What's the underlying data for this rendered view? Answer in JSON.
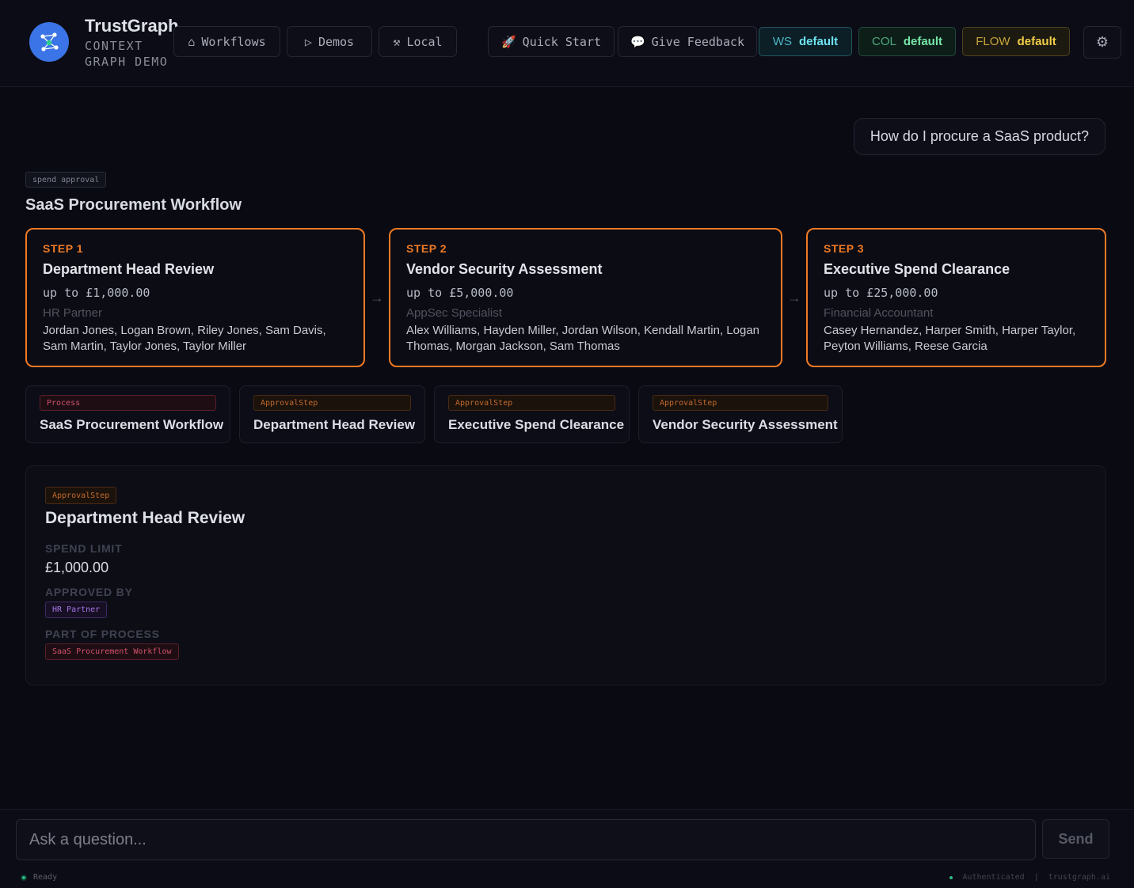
{
  "header": {
    "brand_title": "TrustGraph",
    "brand_subtitle": "CONTEXT GRAPH DEMO",
    "nav": [
      {
        "icon": "home-icon",
        "glyph": "⌂",
        "label": "Workflows"
      },
      {
        "icon": "play-icon",
        "glyph": "▷",
        "label": "Demos"
      },
      {
        "icon": "tools-icon",
        "glyph": "⚒",
        "label": "Local"
      }
    ],
    "quick_start": {
      "glyph": "🚀",
      "label": "Quick Start"
    },
    "feedback": {
      "glyph": "💬",
      "label": "Give Feedback"
    },
    "ws": {
      "key": "WS",
      "value": "default"
    },
    "col": {
      "key": "COL",
      "value": "default"
    },
    "flow": {
      "key": "FLOW",
      "value": "default"
    },
    "settings_glyph": "⚙"
  },
  "chat": {
    "user_message": "How do I procure a SaaS product?"
  },
  "workflow": {
    "tag": "spend approval",
    "title": "SaaS Procurement Workflow",
    "arrow": "→",
    "steps": [
      {
        "label": "STEP 1",
        "title": "Department Head Review",
        "limit": "up to £1,000.00",
        "role": "HR Partner",
        "people": "Jordan Jones, Logan Brown, Riley Jones, Sam Davis, Sam Martin, Taylor Jones, Taylor Miller"
      },
      {
        "label": "STEP 2",
        "title": "Vendor Security Assessment",
        "limit": "up to £5,000.00",
        "role": "AppSec Specialist",
        "people": "Alex Williams, Hayden Miller, Jordan Wilson, Kendall Martin, Logan Thomas, Morgan Jackson, Sam Thomas"
      },
      {
        "label": "STEP 3",
        "title": "Executive Spend Clearance",
        "limit": "up to £25,000.00",
        "role": "Financial Accountant",
        "people": "Casey Hernandez, Harper Smith, Harper Taylor, Peyton Williams, Reese Garcia"
      }
    ]
  },
  "entities": [
    {
      "type": "Process",
      "name": "SaaS Procurement Workflow"
    },
    {
      "type": "ApprovalStep",
      "name": "Department Head Review"
    },
    {
      "type": "ApprovalStep",
      "name": "Executive Spend Clearance"
    },
    {
      "type": "ApprovalStep",
      "name": "Vendor Security Assessment"
    }
  ],
  "detail": {
    "type": "ApprovalStep",
    "title": "Department Head Review",
    "spend_limit_label": "SPEND LIMIT",
    "spend_limit_value": "£1,000.00",
    "approved_by_label": "APPROVED BY",
    "approved_by_value": "HR Partner",
    "part_of_label": "PART OF PROCESS",
    "part_of_value": "SaaS Procurement Workflow"
  },
  "composer": {
    "placeholder": "Ask a question...",
    "send_label": "Send"
  },
  "status": {
    "left": "Ready",
    "auth": "Authenticated",
    "separator": "|",
    "site": "trustgraph.ai"
  }
}
